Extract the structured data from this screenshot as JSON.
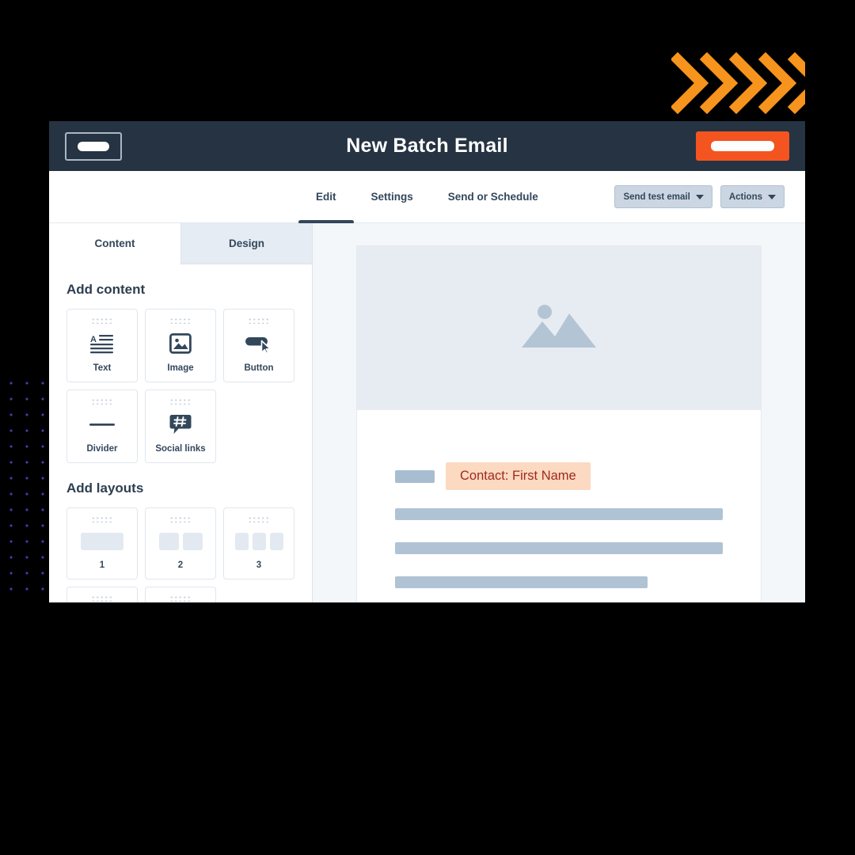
{
  "window": {
    "header": {
      "title": "New Batch Email",
      "logo_button_name": "logo-button",
      "primary_button_name": "primary-action-button",
      "bg_color": "#253342",
      "primary_color": "#f4541f"
    },
    "nav": {
      "tabs": [
        {
          "label": "Edit",
          "active": true
        },
        {
          "label": "Settings",
          "active": false
        },
        {
          "label": "Send or Schedule",
          "active": false
        }
      ],
      "buttons": [
        {
          "label": "Send test email",
          "icon": "chevron-down-icon"
        },
        {
          "label": "Actions",
          "icon": "chevron-down-icon"
        }
      ]
    },
    "sidebar": {
      "tabs": [
        {
          "label": "Content",
          "active": true
        },
        {
          "label": "Design",
          "active": false
        }
      ],
      "sections": [
        {
          "title": "Add content",
          "cards": [
            {
              "label": "Text",
              "icon": "text-align-icon"
            },
            {
              "label": "Image",
              "icon": "image-icon"
            },
            {
              "label": "Button",
              "icon": "button-cursor-icon"
            },
            {
              "label": "Divider",
              "icon": "divider-line-icon"
            },
            {
              "label": "Social links",
              "icon": "hashtag-bubble-icon"
            }
          ]
        },
        {
          "title": "Add layouts",
          "cards": [
            {
              "label": "1",
              "columns": 1
            },
            {
              "label": "2",
              "columns": 2
            },
            {
              "label": "3",
              "columns": 3
            },
            {
              "label": "",
              "columns": 1
            },
            {
              "label": "",
              "columns": 2
            }
          ]
        }
      ]
    },
    "preview": {
      "hero_image_icon": "image-placeholder-icon",
      "personalization_token": "Contact: First Name",
      "token_color": "#9e2a1c",
      "token_bg_color": "#fcd9c1",
      "body_bars": [
        {
          "width_pct": 100
        },
        {
          "width_pct": 100
        },
        {
          "width_pct": 77
        }
      ]
    }
  },
  "decoration": {
    "chevron_count": 5,
    "chevron_color": "#f7941d",
    "dot_color": "#4b3a9e",
    "background_color": "#000000"
  }
}
